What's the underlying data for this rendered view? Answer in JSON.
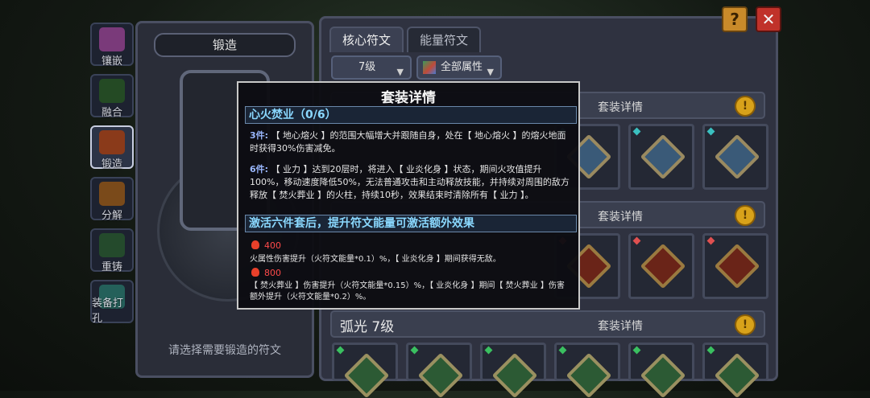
{
  "top_buttons": {
    "help": "?",
    "close": "✕"
  },
  "sidebar": {
    "items": [
      {
        "label": "镶嵌",
        "icon": "inlay-icon",
        "color": "#c06ac0"
      },
      {
        "label": "融合",
        "icon": "fusion-icon",
        "color": "#3a8a3a"
      },
      {
        "label": "锻造",
        "icon": "forge-icon",
        "color": "#c0502a"
      },
      {
        "label": "分解",
        "icon": "decompose-icon",
        "color": "#c07a2a"
      },
      {
        "label": "重铸",
        "icon": "recast-icon",
        "color": "#3a8a4a"
      },
      {
        "label": "装备打孔",
        "icon": "socket-icon",
        "color": "#3aa8a0"
      }
    ]
  },
  "forge_panel": {
    "title": "锻造",
    "hint": "请选择需要锻造的符文"
  },
  "main": {
    "tabs": [
      {
        "label": "核心符文",
        "active": true
      },
      {
        "label": "能量符文",
        "active": false
      }
    ],
    "level_dropdown": "7级",
    "attr_dropdown": "全部属性",
    "sections": [
      {
        "title": "",
        "detail_label": "套装详情",
        "coin": "!"
      },
      {
        "title": "",
        "detail_label": "套装详情",
        "coin": "!"
      },
      {
        "title": "弧光 7级",
        "detail_label": "套装详情",
        "coin": "!"
      }
    ]
  },
  "popup": {
    "title": "套装详情",
    "set_name": "心火焚业（0/6）",
    "bonus3_tag": "3件:",
    "bonus3_text": "【 地心熔火 】的范围大幅增大并跟随自身，处在【 地心熔火 】的熔火地面时获得30%伤害减免。",
    "bonus6_tag": "6件:",
    "bonus6_text": "【 业力 】达到20层时，将进入【 业炎化身 】状态，期间火攻值提升100%，移动速度降低50%，无法普通攻击和主动释放技能，并持续对周围的敌方释放【 焚火葬业 】的火柱，持续10秒，效果结束时清除所有【 业力 】。",
    "extra_head": "激活六件套后，提升符文能量可激活额外效果",
    "tier1_value": "400",
    "tier1_text": "火属性伤害提升（火符文能量*0.1）%，【 业炎化身 】期间获得无敌。",
    "tier2_value": "800",
    "tier2_text": "【 焚火葬业 】伤害提升（火符文能量*0.15）%，【 业炎化身 】期间【 焚火葬业 】伤害额外提升（火符文能量*0.2）%。"
  }
}
